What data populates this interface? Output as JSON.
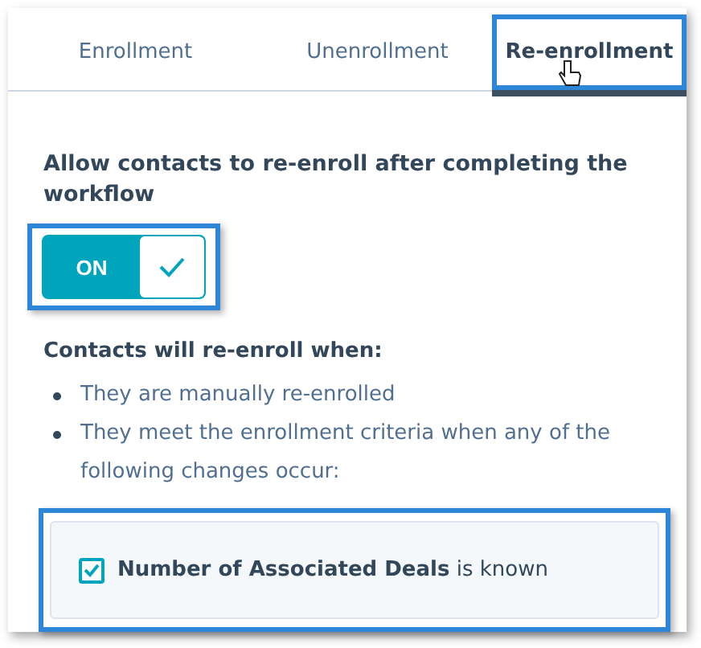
{
  "tabs": [
    {
      "label": "Enrollment",
      "selected": false
    },
    {
      "label": "Unenrollment",
      "selected": false
    },
    {
      "label": "Re-enrollment",
      "selected": true
    }
  ],
  "setting": {
    "label": "Allow contacts to re-enroll after completing the workflow",
    "toggle": {
      "on": true,
      "label": "ON"
    }
  },
  "conditions": {
    "heading": "Contacts will re-enroll when:",
    "items": [
      "They are manually re-enrolled",
      "They meet the enrollment criteria when any of the following changes occur:"
    ]
  },
  "criteria": [
    {
      "checked": true,
      "text": "**Number of Associated Deals** is known"
    }
  ]
}
